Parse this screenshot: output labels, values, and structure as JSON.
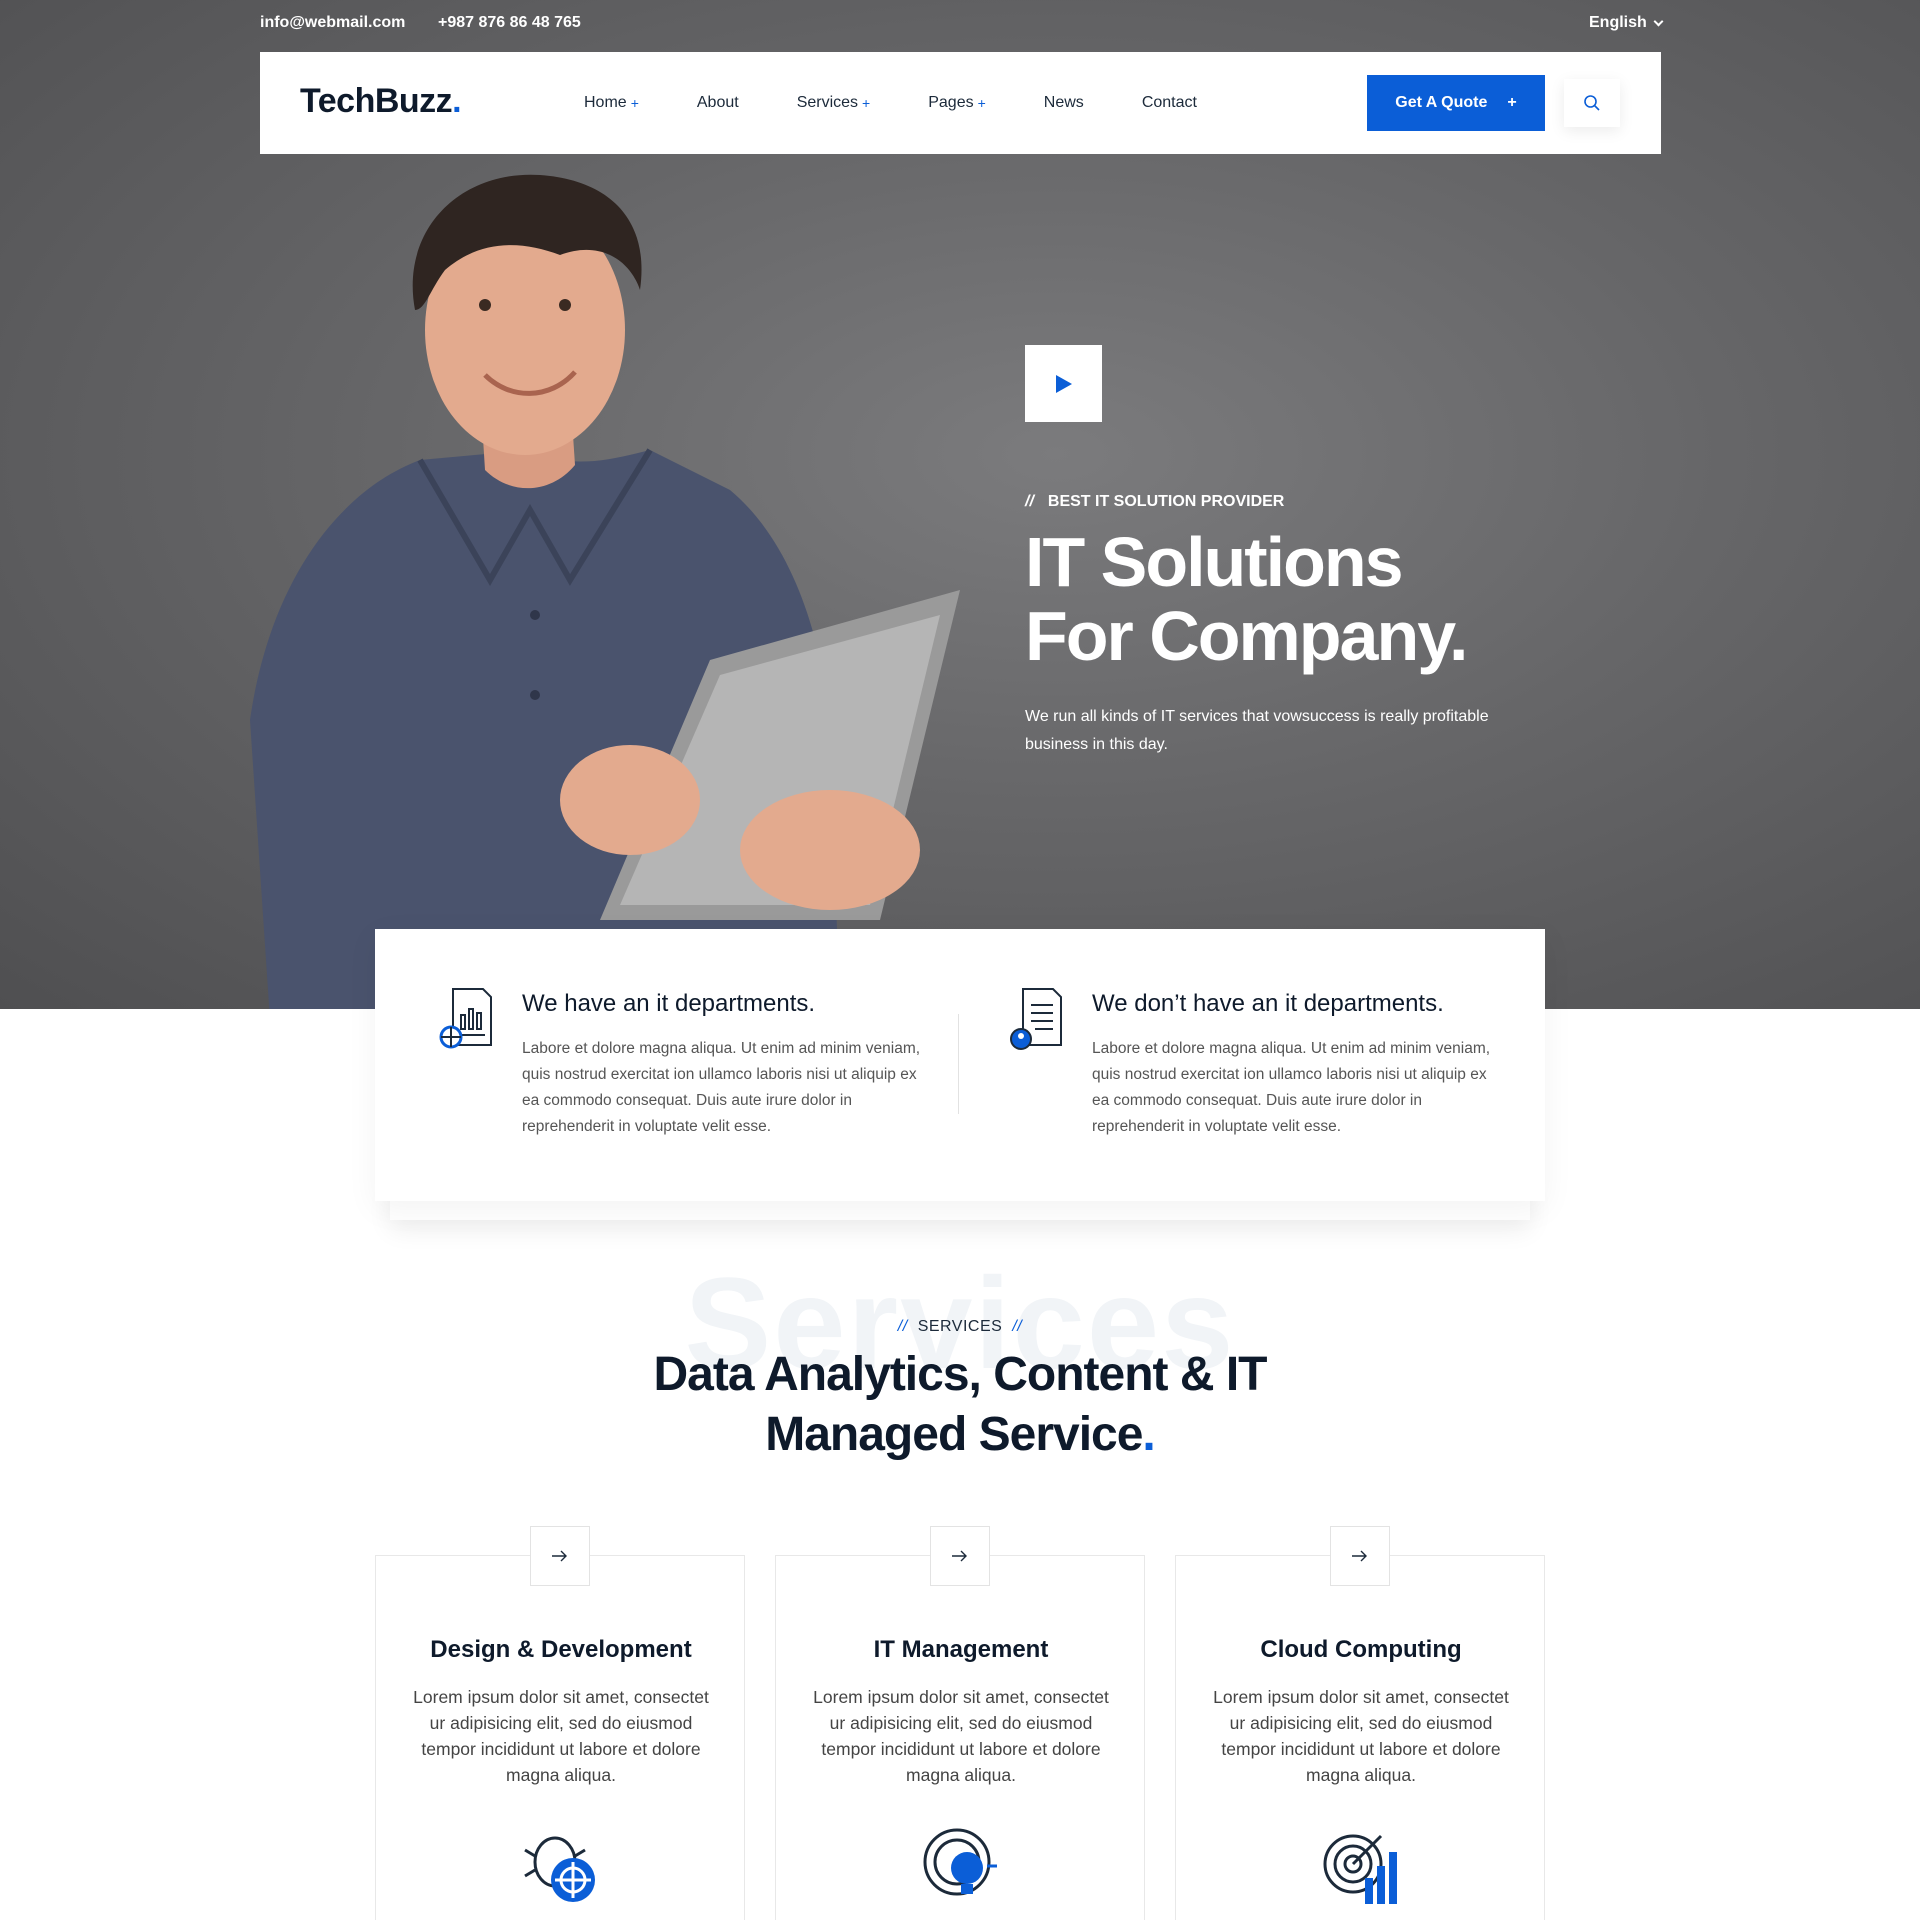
{
  "topbar": {
    "email": "info@webmail.com",
    "phone": "+987 876 86 48 765",
    "language": "English"
  },
  "navbar": {
    "logo": "TechBuzz",
    "logo_dot": ".",
    "items": [
      {
        "label": "Home",
        "has_submenu": true
      },
      {
        "label": "About",
        "has_submenu": false
      },
      {
        "label": "Services",
        "has_submenu": true
      },
      {
        "label": "Pages",
        "has_submenu": true
      },
      {
        "label": "News",
        "has_submenu": false
      },
      {
        "label": "Contact",
        "has_submenu": false
      }
    ],
    "submenu_marker": "+",
    "quote_button": "Get A Quote",
    "quote_plus": "+",
    "search_icon": "search-icon"
  },
  "hero": {
    "tagline_prefix": "//",
    "tagline": "BEST IT SOLUTION PROVIDER",
    "title_line1": "IT Solutions",
    "title_line2": "For Company.",
    "description": "We run all kinds of IT services that vowsuccess is really profitable business in this day.",
    "play_icon": "play-icon"
  },
  "features": [
    {
      "title": "We have an it departments.",
      "text": "Labore et dolore magna aliqua. Ut enim ad minim veniam, quis nostrud exercitat ion ullamco laboris nisi ut aliquip ex ea commodo consequat. Duis aute irure dolor in reprehenderit in voluptate velit esse.",
      "icon": "report-chart-icon"
    },
    {
      "title": "We don’t have an it departments.",
      "text": "Labore et dolore magna aliqua. Ut enim ad minim veniam, quis nostrud exercitat ion ullamco laboris nisi ut aliquip ex ea commodo consequat. Duis aute irure dolor in reprehenderit in voluptate velit esse.",
      "icon": "document-user-icon"
    }
  ],
  "services": {
    "ghost": "Services",
    "eyebrow_prefix": "//",
    "eyebrow": "SERVICES",
    "eyebrow_suffix": "//",
    "title_line1": "Data Analytics, Content & IT",
    "title_line2": "Managed Service",
    "title_dot": ".",
    "cards": [
      {
        "title": "Design & Development",
        "text": "Lorem ipsum dolor sit amet, consectet ur adipisicing elit, sed do eiusmod tempor incididunt ut labore et dolore magna aliqua.",
        "icon": "bug-target-icon"
      },
      {
        "title": "IT Management",
        "text": "Lorem ipsum dolor sit amet, consectet ur adipisicing elit, sed do eiusmod tempor incididunt ut labore et dolore magna aliqua.",
        "icon": "brain-bulb-icon"
      },
      {
        "title": "Cloud Computing",
        "text": "Lorem ipsum dolor sit amet, consectet ur adipisicing elit, sed do eiusmod tempor incididunt ut labore et dolore magna aliqua.",
        "icon": "target-chart-icon"
      }
    ]
  },
  "colors": {
    "accent": "#0b5ed7",
    "dark": "#0e1a2b",
    "hero_bg": "#666668"
  }
}
